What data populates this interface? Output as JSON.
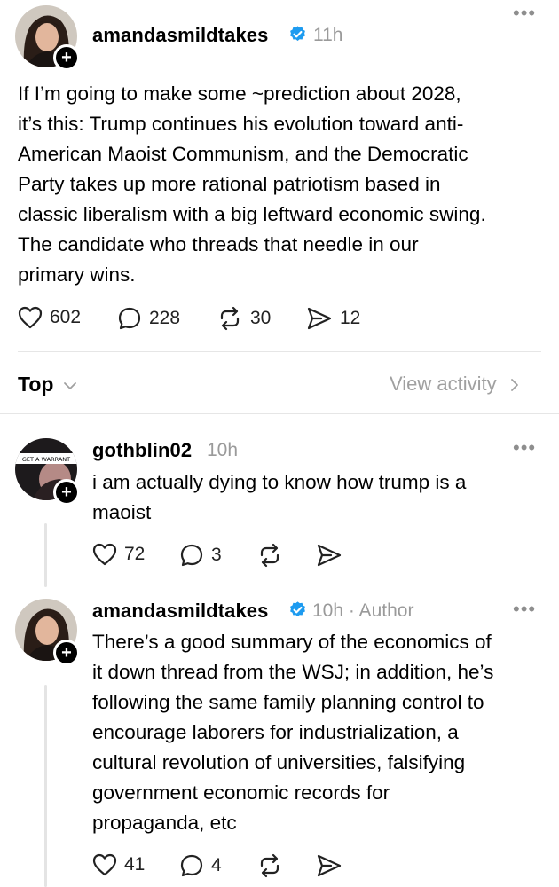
{
  "main_post": {
    "username": "amandasmildtakes",
    "verified": true,
    "time": "11h",
    "text_lines": [
      "If I’m going to make some ~prediction about 2028,",
      "it’s this: Trump continues his evolution toward anti-",
      "American Maoist Communism, and the Democratic",
      "Party takes up more rational patriotism based in",
      "classic liberalism with a big leftward economic swing.",
      "The candidate who threads that needle in our",
      "primary wins."
    ],
    "likes": "602",
    "replies": "228",
    "reposts": "30",
    "shares": "12"
  },
  "sort_bar": {
    "sort_label": "Top",
    "view_activity_label": "View activity"
  },
  "replies": [
    {
      "username": "gothblin02",
      "time": "10h",
      "avatar_text": "GET A WARRANT",
      "text_lines": [
        "i am actually dying to know how trump is a",
        "maoist"
      ],
      "likes": "72",
      "replies": "3"
    },
    {
      "username": "amandasmildtakes",
      "verified": true,
      "time": "10h",
      "author_tag": "· Author",
      "text_lines": [
        "There’s a good summary of the economics of",
        "it down thread from the WSJ; in addition, he’s",
        "following the same family planning control to",
        "encourage laborers for industrialization, a",
        "cultural revolution of universities, falsifying",
        "government economic records for",
        "propaganda, etc"
      ],
      "likes": "41",
      "replies": "4"
    }
  ],
  "icons": {
    "more": "more-horizontal-icon",
    "like": "heart-icon",
    "reply": "comment-bubble-icon",
    "repost": "repost-arrows-icon",
    "share": "send-paper-plane-icon",
    "verified": "verified-badge-icon",
    "follow": "plus-icon",
    "chevron_down": "chevron-down-icon",
    "chevron_right": "chevron-right-icon"
  },
  "colors": {
    "verified_blue": "#1d9bf0",
    "muted_text": "#9a9a9a",
    "divider": "#e6e6e6"
  }
}
